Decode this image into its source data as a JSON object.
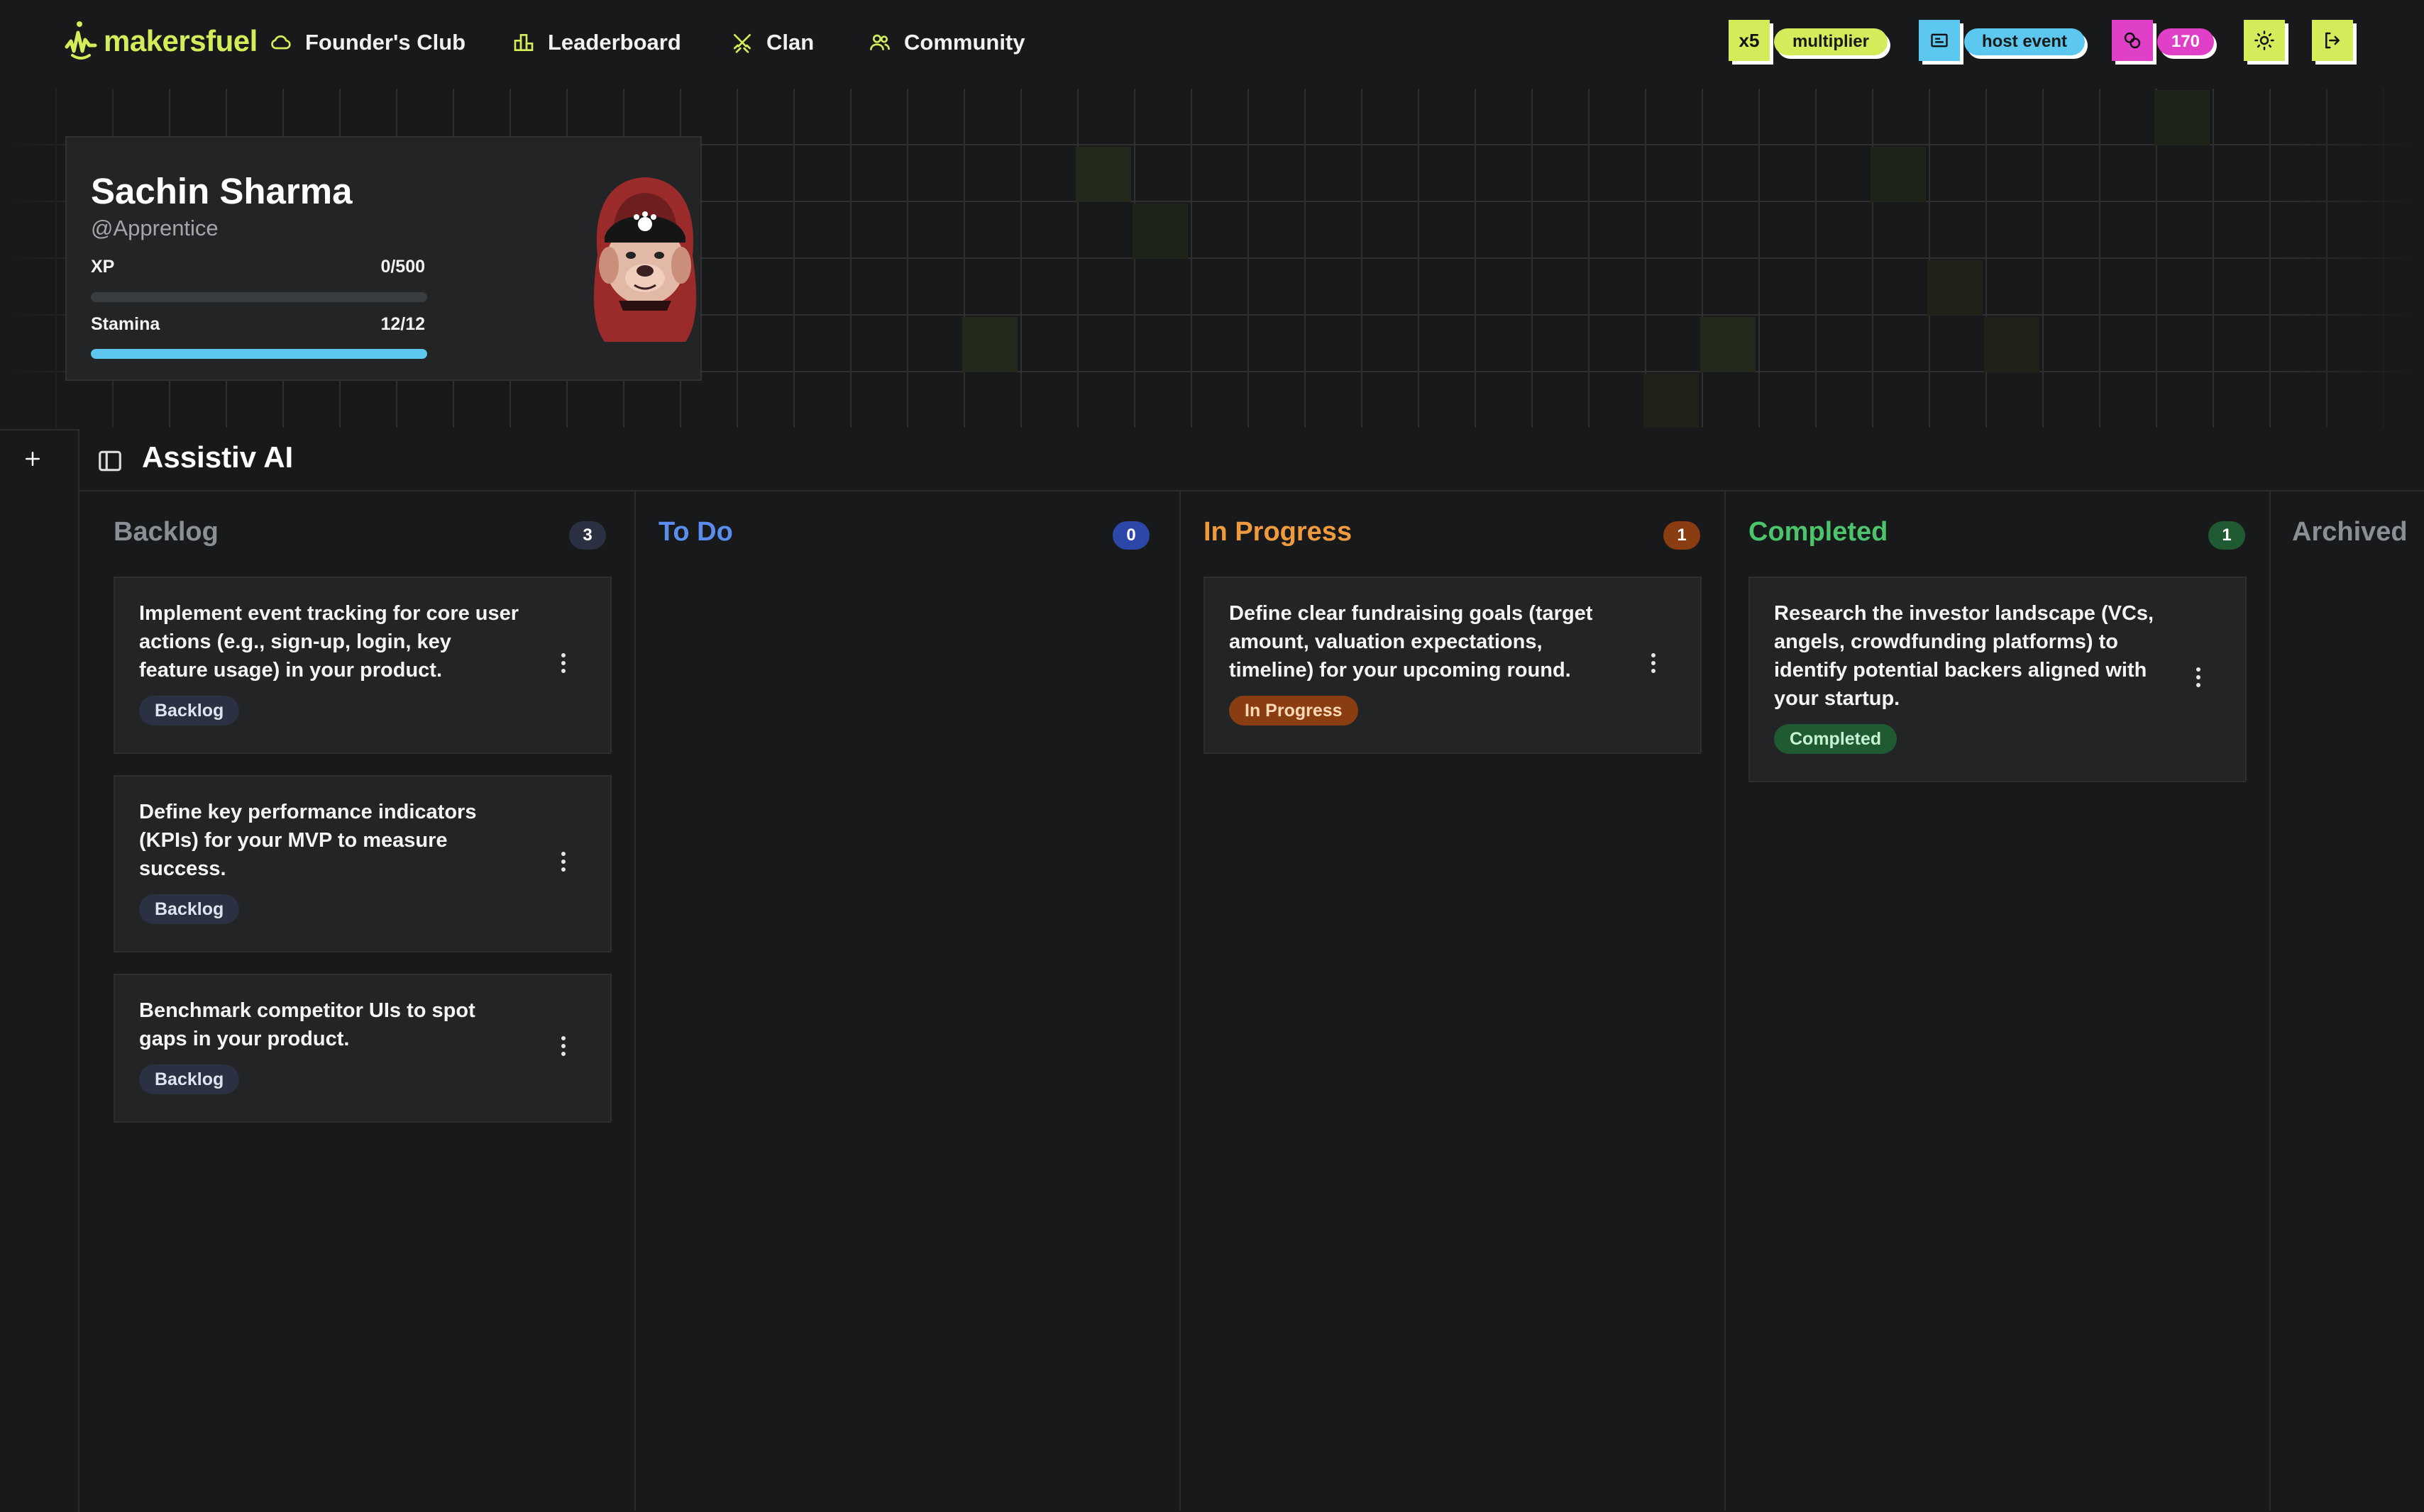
{
  "nav": {
    "logo_text": "makersfuel",
    "items": [
      {
        "label": "Founder's Club",
        "icon": "cloud-icon"
      },
      {
        "label": "Leaderboard",
        "icon": "podium-icon"
      },
      {
        "label": "Clan",
        "icon": "crossed-swords-icon"
      },
      {
        "label": "Community",
        "icon": "users-icon"
      }
    ],
    "multiplier": {
      "badge": "x5",
      "label": "multiplier"
    },
    "host_event": {
      "label": "host event"
    },
    "coins": {
      "value": "170"
    }
  },
  "profile": {
    "name": "Sachin Sharma",
    "handle": "@Apprentice",
    "xp_label": "XP",
    "xp_value": "0/500",
    "xp_fraction": 0,
    "stamina_label": "Stamina",
    "stamina_value": "12/12",
    "stamina_fraction": 1
  },
  "board": {
    "title": "Assistiv AI",
    "columns": [
      {
        "title": "Backlog",
        "count": "3",
        "color": "#8a8f96",
        "count_bg": "#2b3142",
        "count_fg": "#ffffff",
        "cards": [
          {
            "text": "Implement event tracking for core user actions (e.g., sign-up, login, key feature usage) in your product.",
            "tag": "Backlog"
          },
          {
            "text": "Define key performance indicators (KPIs) for your MVP to measure success.",
            "tag": "Backlog"
          },
          {
            "text": "Benchmark competitor UIs to spot gaps in your product.",
            "tag": "Backlog"
          }
        ]
      },
      {
        "title": "To Do",
        "count": "0",
        "color": "#5b8def",
        "count_bg": "#2d47a8",
        "count_fg": "#ffffff",
        "cards": []
      },
      {
        "title": "In Progress",
        "count": "1",
        "color": "#f09a3e",
        "count_bg": "#8a3d10",
        "count_fg": "#ffffff",
        "cards": [
          {
            "text": "Define clear fundraising goals (target amount, valuation expectations, timeline) for your upcoming round.",
            "tag": "In Progress"
          }
        ]
      },
      {
        "title": "Completed",
        "count": "1",
        "color": "#4cc46c",
        "count_bg": "#1f5a32",
        "count_fg": "#ffffff",
        "cards": [
          {
            "text": "Research the investor landscape (VCs, angels, crowdfunding platforms) to identify potential backers aligned with your startup.",
            "tag": "Completed"
          }
        ]
      },
      {
        "title": "Archived",
        "color": "#8a8f96",
        "cards": []
      }
    ]
  },
  "colors": {
    "accent": "#d4ec59",
    "background": "#18191a",
    "host_event": "#5cc7ef",
    "coins": "#e040c8",
    "stamina": "#5cc7ef"
  }
}
